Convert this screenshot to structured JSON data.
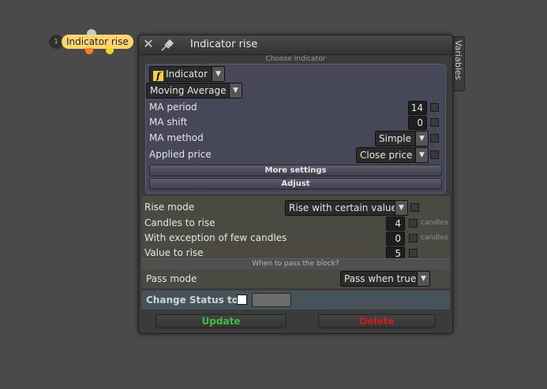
{
  "node_chip": {
    "number": "1",
    "label": "Indicator rise"
  },
  "dialog": {
    "title": "Indicator rise",
    "side_tab": "Variables",
    "section_choose": "Choose Indicator",
    "indicator_dropdown": "Indicator",
    "indicator_type": "Moving Average",
    "params": [
      {
        "label": "MA period",
        "value": "14"
      },
      {
        "label": "MA shift",
        "value": "0"
      },
      {
        "label": "MA method",
        "value": "Simple"
      },
      {
        "label": "Applied price",
        "value": "Close price"
      }
    ],
    "more_settings": "More settings",
    "adjust": "Adjust",
    "rise_mode_label": "Rise mode",
    "rise_mode_value": "Rise with certain value",
    "candles_to_rise_label": "Candles to rise",
    "candles_to_rise_value": "4",
    "candles_unit_1": "candles",
    "exception_label": "With exception of few candles",
    "exception_value": "0",
    "candles_unit_2": "candles",
    "value_to_rise_label": "Value to rise",
    "value_to_rise_value": "5",
    "when_to_pass": "When to pass the block?",
    "pass_mode_label": "Pass mode",
    "pass_mode_value": "Pass when true",
    "change_status_label": "Change Status to",
    "update_label": "Update",
    "delete_label": "Delete"
  },
  "colors": {
    "background": "#4a4a4a",
    "chip": "#ffd66e",
    "update": "#3fbf3f",
    "delete": "#d41a1a"
  }
}
